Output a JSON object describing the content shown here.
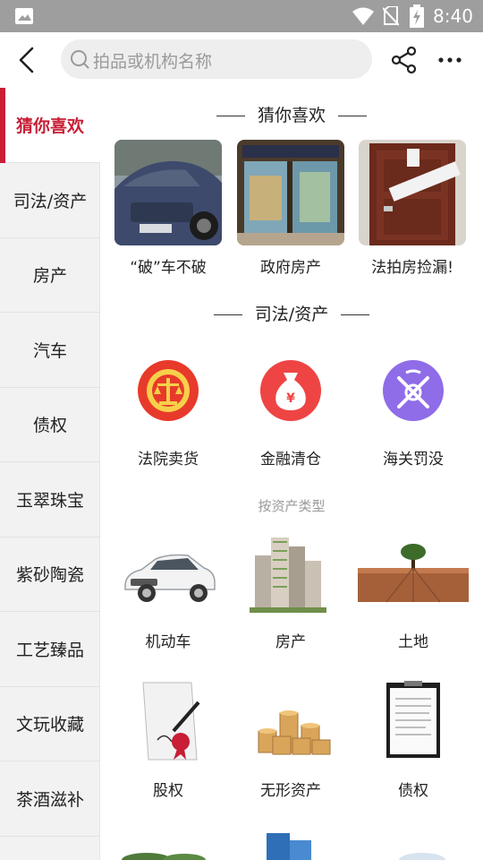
{
  "status_bar": {
    "time": "8:40"
  },
  "search": {
    "placeholder": "拍品或机构名称"
  },
  "sidebar": {
    "items": [
      {
        "label": "猜你喜欢"
      },
      {
        "label": "司法/资产"
      },
      {
        "label": "房产"
      },
      {
        "label": "汽车"
      },
      {
        "label": "债权"
      },
      {
        "label": "玉翠珠宝"
      },
      {
        "label": "紫砂陶瓷"
      },
      {
        "label": "工艺臻品"
      },
      {
        "label": "文玩收藏"
      },
      {
        "label": "茶酒滋补"
      }
    ]
  },
  "main": {
    "guess_title": "猜你喜欢",
    "guess_items": [
      {
        "label": "“破”车不破"
      },
      {
        "label": "政府房产"
      },
      {
        "label": "法拍房捡漏!"
      }
    ],
    "judicial_title": "司法/资产",
    "judicial_items": [
      {
        "label": "法院卖货"
      },
      {
        "label": "金融清仓"
      },
      {
        "label": "海关罚没"
      }
    ],
    "asset_type_heading": "按资产类型",
    "asset_items": [
      {
        "label": "机动车"
      },
      {
        "label": "房产"
      },
      {
        "label": "土地"
      },
      {
        "label": "股权"
      },
      {
        "label": "无形资产"
      },
      {
        "label": "债权"
      }
    ]
  },
  "colors": {
    "accent": "#c81e36",
    "sidebar_bg": "#f2f2f2",
    "status_bar": "#9e9e9e"
  }
}
